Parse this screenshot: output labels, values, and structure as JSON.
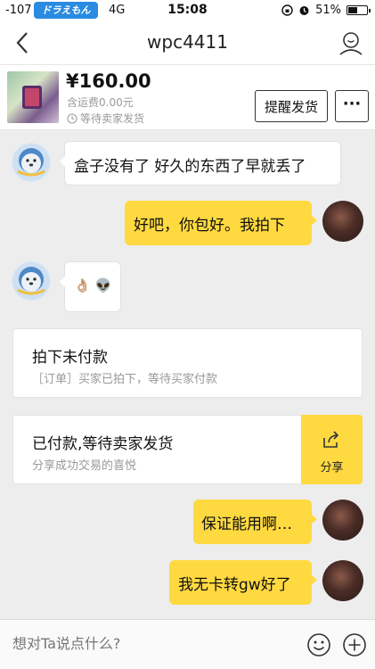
{
  "status": {
    "signal": "-107",
    "carrier": "ドラえもん",
    "network": "4G",
    "time": "15:08",
    "battery": "51%",
    "battery_level": 0.51
  },
  "nav": {
    "title": "wpc4411"
  },
  "product": {
    "price": "¥160.00",
    "shipping": "含运费0.00元",
    "status": "等待卖家发货",
    "remind_label": "提醒发货",
    "more_label": "···"
  },
  "messages": [
    {
      "side": "left",
      "text": "盒子没有了 好久的东西了早就丢了"
    },
    {
      "side": "right",
      "text": "好吧，你包好。我拍下"
    },
    {
      "side": "left",
      "text": "👌🏼 👽"
    },
    {
      "side": "right",
      "text": "保证能用啊…"
    },
    {
      "side": "right",
      "text": "我无卡转gw好了"
    }
  ],
  "cards": [
    {
      "title": "拍下未付款",
      "subtitle": "［订单］买家已拍下，等待买家付款"
    },
    {
      "title": "已付款,等待卖家发货",
      "subtitle": "分享成功交易的喜悦",
      "action": "分享"
    }
  ],
  "input": {
    "placeholder": "想对Ta说点什么?"
  },
  "colors": {
    "accent": "#ffd940",
    "background": "#ededed"
  }
}
